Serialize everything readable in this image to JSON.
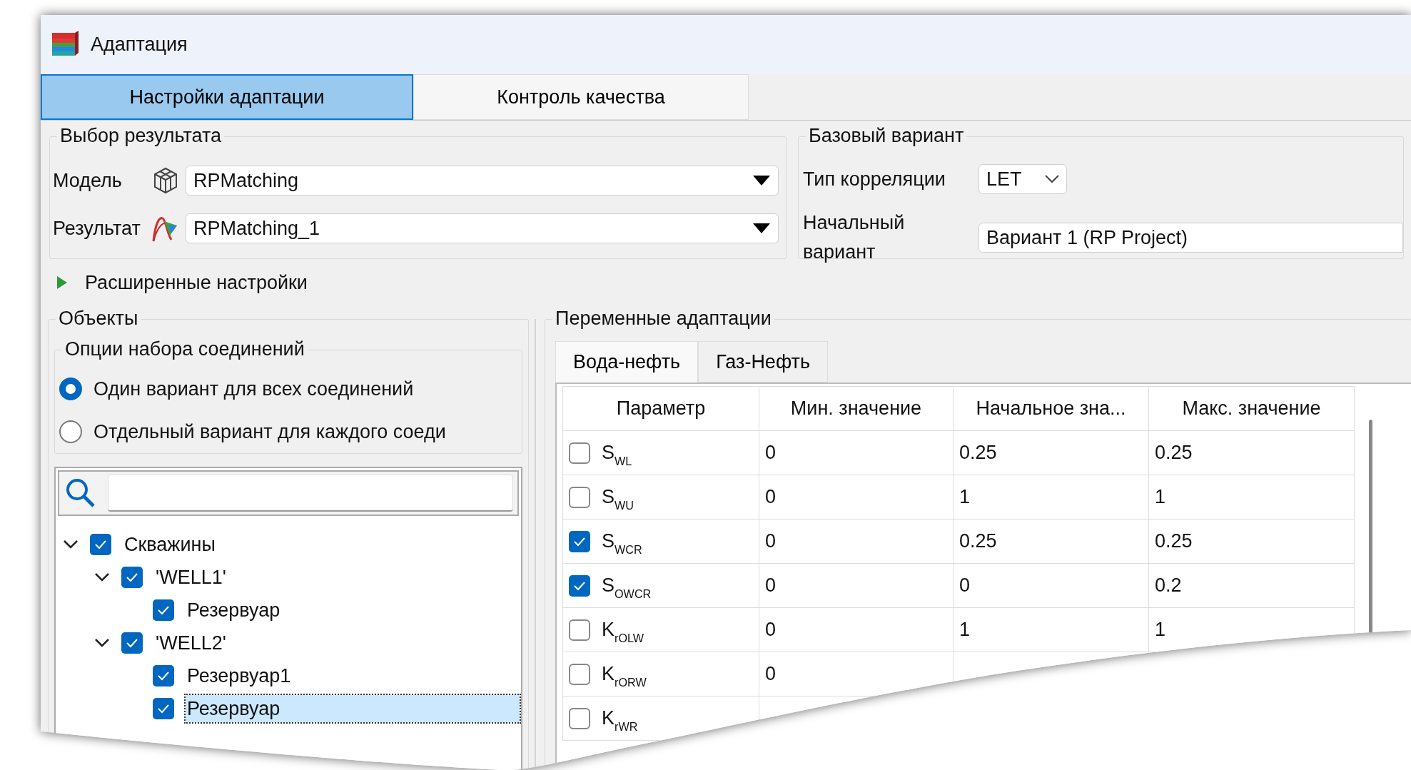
{
  "window": {
    "title": "Адаптация"
  },
  "tabs": [
    {
      "label": "Настройки адаптации",
      "selected": true
    },
    {
      "label": "Контроль качества",
      "selected": false
    }
  ],
  "result_group": {
    "title": "Выбор результата",
    "model": {
      "label": "Модель",
      "value": "RPMatching"
    },
    "result": {
      "label": "Результат",
      "value": "RPMatching_1"
    }
  },
  "base_group": {
    "title": "Базовый вариант",
    "correlation": {
      "label": "Тип корреляции",
      "value": "LET"
    },
    "initial": {
      "label": "Начальный вариант",
      "value": "Вариант 1 (RP Project)"
    }
  },
  "advanced": {
    "label": "Расширенные настройки",
    "expanded": false
  },
  "objects": {
    "title": "Объекты",
    "options_title": "Опции набора соединений",
    "options": [
      {
        "label": "Один вариант для всех соединений",
        "selected": true
      },
      {
        "label": "Отдельный вариант для каждого соеди",
        "selected": false
      }
    ],
    "tree": [
      {
        "label": "Скважины",
        "checked": true,
        "expanded": true,
        "selected": false,
        "children": [
          {
            "label": "'WELL1'",
            "checked": true,
            "expanded": true,
            "selected": false,
            "children": [
              {
                "label": "Резервуар",
                "checked": true,
                "selected": false
              }
            ]
          },
          {
            "label": "'WELL2'",
            "checked": true,
            "expanded": true,
            "selected": false,
            "children": [
              {
                "label": "Резервуар1",
                "checked": true,
                "selected": false
              },
              {
                "label": "Резервуар",
                "checked": true,
                "selected": true
              }
            ]
          }
        ]
      }
    ]
  },
  "variables": {
    "title": "Переменные адаптации",
    "tabs": [
      {
        "label": "Вода-нефть",
        "selected": true
      },
      {
        "label": "Газ-Нефть",
        "selected": false
      }
    ],
    "columns": [
      "Параметр",
      "Мин. значение",
      "Начальное зна...",
      "Макс. значение"
    ],
    "rows": [
      {
        "checked": false,
        "parameter": "S$_{WL}$",
        "min": "0",
        "start": "0.25",
        "max": "0.25"
      },
      {
        "checked": false,
        "parameter": "S$_{WU}$",
        "min": "0",
        "start": "1",
        "max": "1"
      },
      {
        "checked": true,
        "parameter": "S$_{WCR}$",
        "min": "0",
        "start": "0.25",
        "max": "0.25"
      },
      {
        "checked": true,
        "parameter": "S$_{OWCR}$",
        "min": "0",
        "start": "0",
        "max": "0.2"
      },
      {
        "checked": false,
        "parameter": "K$_{rOLW}$",
        "min": "0",
        "start": "1",
        "max": "1"
      },
      {
        "checked": false,
        "parameter": "K$_{rORW}$",
        "min": "0"
      },
      {
        "checked": false,
        "parameter": "K$_{rWR}$"
      }
    ]
  }
}
